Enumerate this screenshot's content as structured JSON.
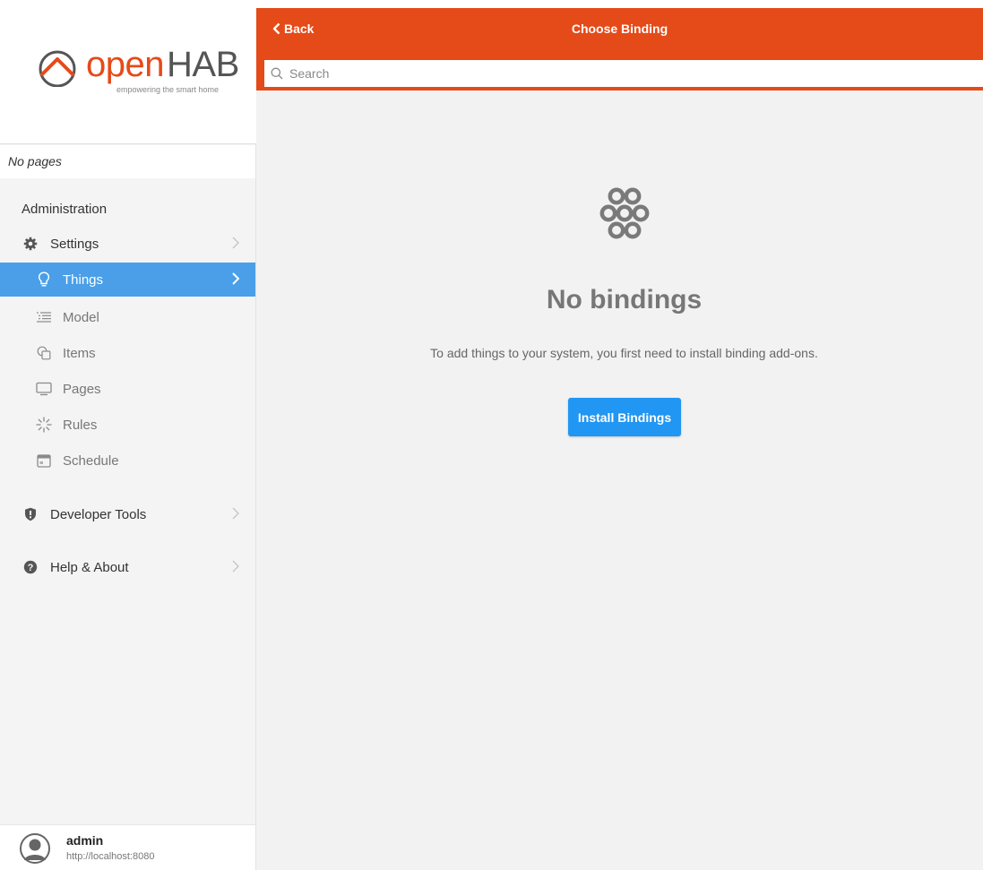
{
  "brand": {
    "name_part1": "open",
    "name_part2": "HAB",
    "tagline": "empowering the smart home"
  },
  "sidebar": {
    "no_pages": "No pages",
    "section_header": "Administration",
    "items": [
      {
        "label": "Settings",
        "icon": "gear-icon"
      },
      {
        "label": "Things",
        "icon": "lightbulb-icon",
        "active": true
      },
      {
        "label": "Model",
        "icon": "list-icon"
      },
      {
        "label": "Items",
        "icon": "items-icon"
      },
      {
        "label": "Pages",
        "icon": "monitor-icon"
      },
      {
        "label": "Rules",
        "icon": "sparkle-icon"
      },
      {
        "label": "Schedule",
        "icon": "calendar-icon"
      },
      {
        "label": "Developer Tools",
        "icon": "shield-icon"
      },
      {
        "label": "Help & About",
        "icon": "question-icon"
      }
    ]
  },
  "user": {
    "name": "admin",
    "url": "http://localhost:8080"
  },
  "navbar": {
    "back_label": "Back",
    "title": "Choose Binding",
    "search_placeholder": "Search"
  },
  "empty_state": {
    "icon": "rings-icon",
    "title": "No bindings",
    "description": "To add things to your system, you first need to install binding add-ons.",
    "button_label": "Install Bindings"
  },
  "colors": {
    "header": "#e54a19",
    "active_item": "#4a9fe8",
    "primary_button": "#2196f3",
    "brand_orange": "#e64a19"
  }
}
